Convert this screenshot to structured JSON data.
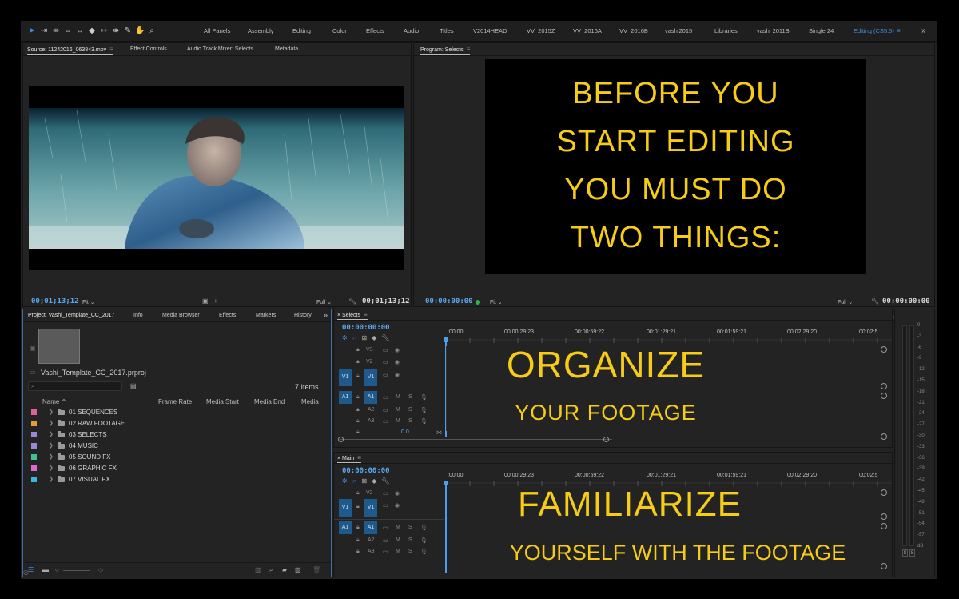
{
  "workspaces": {
    "items": [
      "All Panels",
      "Assembly",
      "Editing",
      "Color",
      "Effects",
      "Audio",
      "Titles",
      "V2014HEAD",
      "VV_2015Z",
      "VV_2016A",
      "VV_2016B",
      "vashi2015",
      "Libraries",
      "vashi 2011B",
      "Single 24",
      "Editing (CS5.5)"
    ],
    "menu_glyph": "≡",
    "more_glyph": "»"
  },
  "source_panel": {
    "tabs": [
      "Source: 11242016_063843.mov",
      "Effect Controls",
      "Audio Track Mixer: Selects",
      "Metadata"
    ],
    "menu_glyph": "≡",
    "timecode_left": "00;01;13;12",
    "fit_label": "Fit",
    "full_label": "Full",
    "timecode_right": "00;01;13;12"
  },
  "program_panel": {
    "title": "Program: Selects",
    "menu_glyph": "≡",
    "timecode_left": "00:00:00:00",
    "fit_label": "Fit",
    "full_label": "Full",
    "timecode_right": "00:00:00:00",
    "slate_lines": [
      "BEFORE YOU",
      "START EDITING",
      "YOU MUST DO",
      "TWO THINGS:"
    ]
  },
  "project_panel": {
    "tabs": [
      "Project: Vashi_Template_CC_2017",
      "Info",
      "Media Browser",
      "Effects",
      "Markers",
      "History"
    ],
    "more_glyph": "»",
    "project_file": "Vashi_Template_CC_2017.prproj",
    "item_count": "7 Items",
    "columns": [
      "Name",
      "Frame Rate",
      "Media Start",
      "Media End",
      "Media"
    ],
    "bins": [
      {
        "label": "01 SEQUENCES",
        "color": "#e0609c"
      },
      {
        "label": "02 RAW FOOTAGE",
        "color": "#e89a3c"
      },
      {
        "label": "03 SELECTS",
        "color": "#9a86d8"
      },
      {
        "label": "04 MUSIC",
        "color": "#9a86d8"
      },
      {
        "label": "05 SOUND FX",
        "color": "#3ec48a"
      },
      {
        "label": "06 GRAPHIC FX",
        "color": "#d86ad0"
      },
      {
        "label": "07 VISUAL FX",
        "color": "#38b8e0"
      }
    ]
  },
  "timeline_selects": {
    "title": "Selects",
    "menu_glyph": "≡",
    "timecode": "00:00:00:00",
    "ruler": [
      ":00:00",
      "00:00:29:23",
      "00:00:59:22",
      "00:01:29:21",
      "00:01:59:21",
      "00:02:29:20",
      "00:02:5"
    ],
    "tracks_video": [
      "V3",
      "V2",
      "V1"
    ],
    "tracks_audio": [
      "A1",
      "A2",
      "A3"
    ],
    "source_v": "V1",
    "source_a": "A1",
    "master_value": "0.0",
    "caption_big": "ORGANIZE",
    "caption_small": "YOUR FOOTAGE"
  },
  "timeline_main": {
    "title": "Main",
    "menu_glyph": "≡",
    "timecode": "00:00:00:00",
    "ruler": [
      ":00:00",
      "00:00:29:23",
      "00:00:59:22",
      "00:01:29:21",
      "00:01:59:21",
      "00:02:29:20",
      "00:02:5"
    ],
    "tracks_video": [
      "V2",
      "V1"
    ],
    "tracks_audio": [
      "A1",
      "A2",
      "A3"
    ],
    "source_v": "V1",
    "source_a": "A1",
    "caption_big": "FAMILIARIZE",
    "caption_small": "YOURSELF WITH THE FOOTAGE"
  },
  "audio_meter": {
    "scale": [
      "0",
      "-3",
      "-6",
      "-9",
      "-12",
      "-15",
      "-18",
      "-21",
      "-24",
      "-27",
      "-30",
      "-33",
      "-36",
      "-39",
      "-42",
      "-45",
      "-48",
      "-51",
      "-54",
      "-57",
      "dB"
    ],
    "solo_labels": [
      "S",
      "S"
    ]
  },
  "track_toggle_labels": {
    "mute": "M",
    "solo": "S"
  }
}
